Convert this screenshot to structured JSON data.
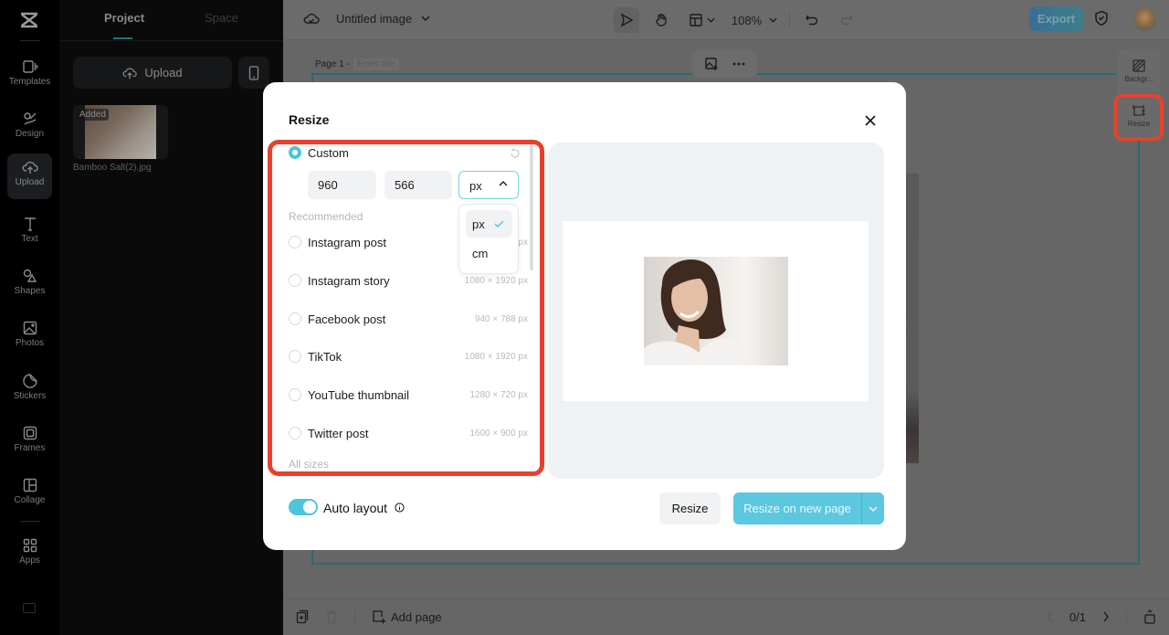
{
  "app": {
    "document_title": "Untitled image",
    "zoom_level": "108%",
    "export_label": "Export"
  },
  "rail": {
    "items": [
      {
        "label": "Templates",
        "icon": "templates-icon"
      },
      {
        "label": "Design",
        "icon": "design-icon"
      },
      {
        "label": "Upload",
        "icon": "upload-icon",
        "active": true
      },
      {
        "label": "Text",
        "icon": "text-icon"
      },
      {
        "label": "Shapes",
        "icon": "shapes-icon"
      },
      {
        "label": "Photos",
        "icon": "photos-icon"
      },
      {
        "label": "Stickers",
        "icon": "stickers-icon"
      },
      {
        "label": "Frames",
        "icon": "frames-icon"
      },
      {
        "label": "Collage",
        "icon": "collage-icon"
      },
      {
        "label": "Apps",
        "icon": "apps-icon"
      }
    ]
  },
  "panel": {
    "tabs": [
      {
        "label": "Project",
        "active": true
      },
      {
        "label": "Space",
        "active": false
      }
    ],
    "upload_label": "Upload",
    "asset": {
      "badge": "Added",
      "filename": "Bamboo Salt(2).jpg"
    }
  },
  "canvas": {
    "page_label": "Page 1 -",
    "page_title_placeholder": "Enter title",
    "side_tools": [
      {
        "label": "Backgr...",
        "icon": "background-icon"
      },
      {
        "label": "Resize",
        "icon": "resize-icon",
        "highlighted": true
      }
    ]
  },
  "bottombar": {
    "add_page_label": "Add page",
    "page_counter": "0/1"
  },
  "modal": {
    "title": "Resize",
    "custom": {
      "label": "Custom",
      "selected": true,
      "width": "960",
      "height": "566",
      "unit": "px"
    },
    "unit_options": [
      {
        "label": "px",
        "selected": true
      },
      {
        "label": "cm",
        "selected": false
      }
    ],
    "recommended_label": "Recommended",
    "presets": [
      {
        "label": "Instagram post",
        "size": "1080 × 1080 px"
      },
      {
        "label": "Instagram story",
        "size": "1080 × 1920 px"
      },
      {
        "label": "Facebook post",
        "size": "940 × 788 px"
      },
      {
        "label": "TikTok",
        "size": "1080 × 1920 px"
      },
      {
        "label": "YouTube thumbnail",
        "size": "1280 × 720 px"
      },
      {
        "label": "Twitter post",
        "size": "1600 × 900 px"
      }
    ],
    "all_sizes_label": "All sizes",
    "auto_layout_label": "Auto layout",
    "auto_layout_on": true,
    "resize_label": "Resize",
    "resize_new_page_label": "Resize on new page"
  },
  "colors": {
    "accent": "#5bc8df",
    "highlight": "#e8412b"
  }
}
